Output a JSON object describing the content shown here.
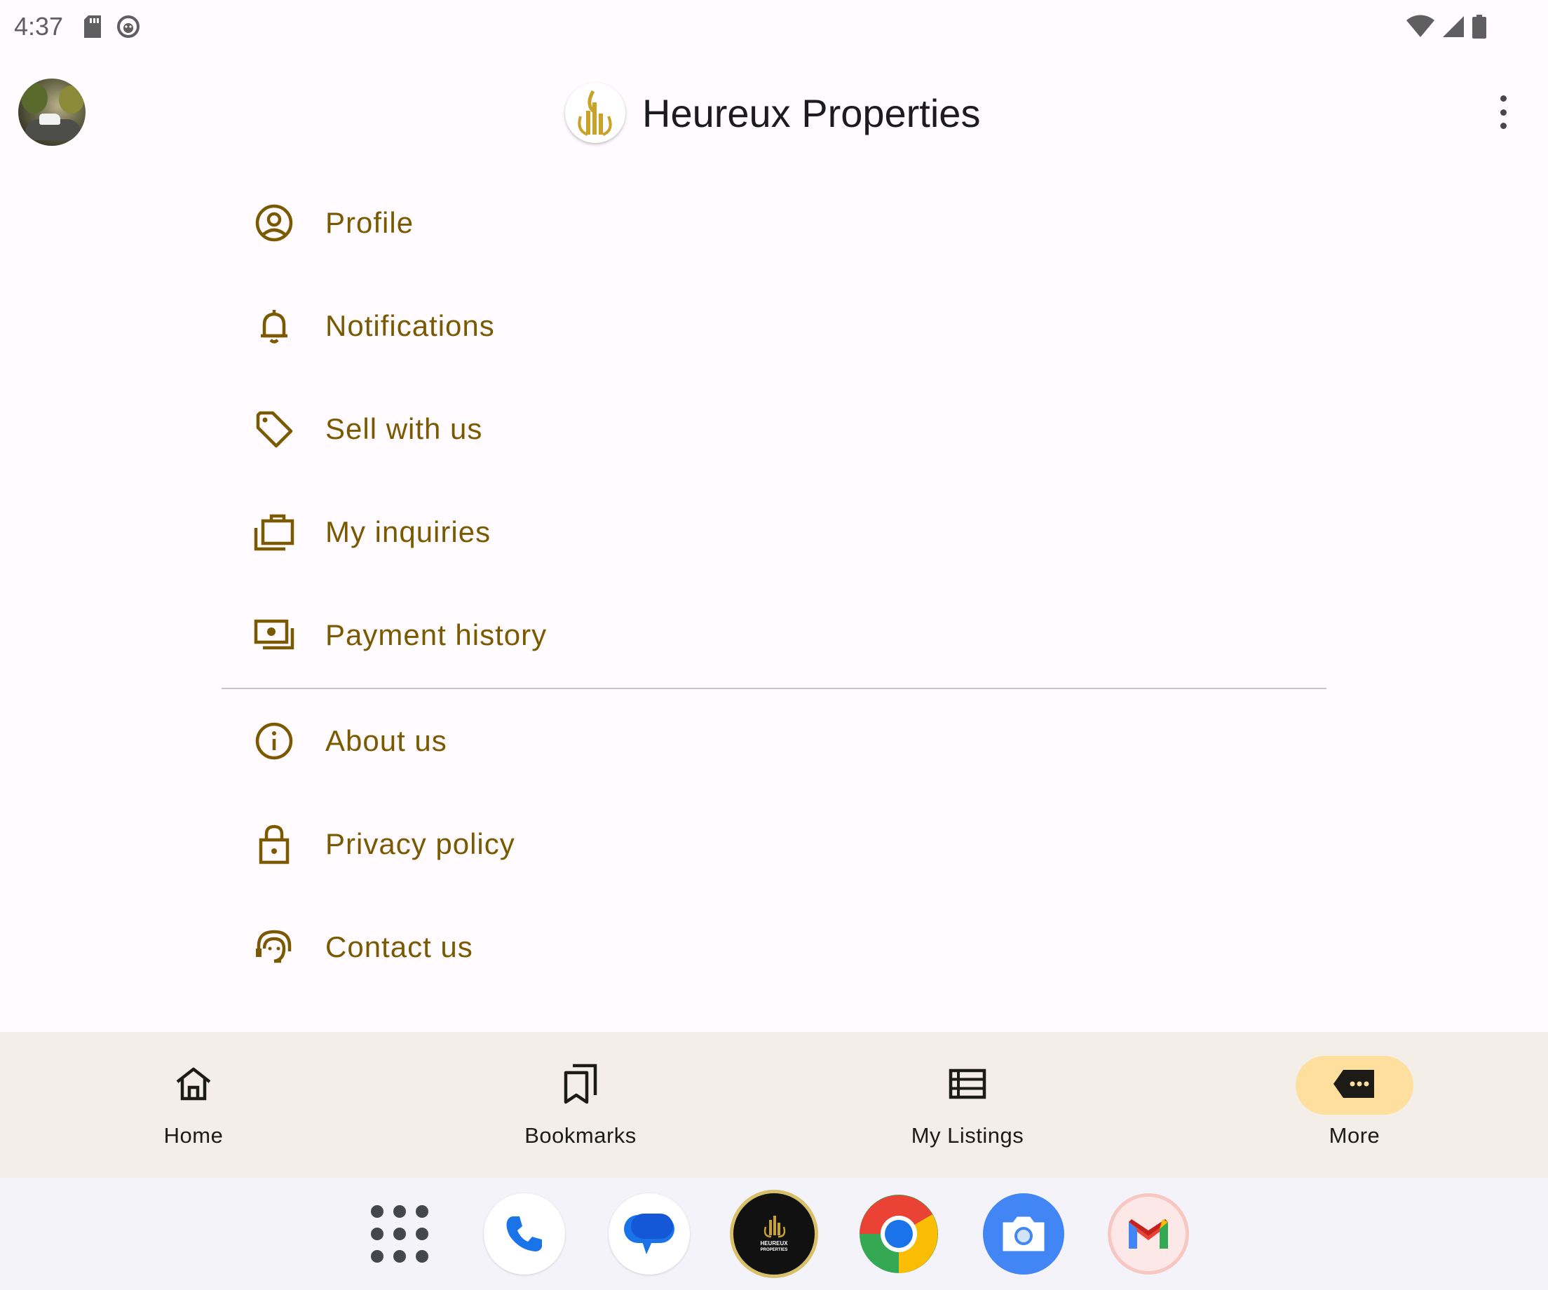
{
  "status_bar": {
    "time": "4:37"
  },
  "app_bar": {
    "title": "Heureux Properties"
  },
  "menu": {
    "items": [
      {
        "label": "Profile",
        "icon": "account-circle-icon"
      },
      {
        "label": "Notifications",
        "icon": "bell-icon"
      },
      {
        "label": "Sell with us",
        "icon": "tag-icon"
      },
      {
        "label": "My inquiries",
        "icon": "briefcase-stack-icon"
      },
      {
        "label": "Payment history",
        "icon": "payments-icon"
      },
      {
        "label": "About us",
        "icon": "info-icon"
      },
      {
        "label": "Privacy policy",
        "icon": "lock-icon"
      },
      {
        "label": "Contact us",
        "icon": "support-agent-icon"
      }
    ]
  },
  "bottom_nav": {
    "items": [
      {
        "label": "Home",
        "icon": "home-icon",
        "active": false
      },
      {
        "label": "Bookmarks",
        "icon": "bookmarks-icon",
        "active": false
      },
      {
        "label": "My Listings",
        "icon": "list-icon",
        "active": false
      },
      {
        "label": "More",
        "icon": "more-icon",
        "active": true
      }
    ]
  },
  "dock": {
    "apps": [
      "app-launcher-icon",
      "phone-icon",
      "messages-icon",
      "heureux-properties-icon",
      "chrome-icon",
      "camera-icon",
      "gmail-icon"
    ],
    "heureux_logo_text": "HEUREUX PROPERTIES"
  },
  "colors": {
    "accent": "#7a5900",
    "nav_active": "#ffdf9e",
    "nav_background": "#f3efe8",
    "background": "#fffbfe"
  }
}
